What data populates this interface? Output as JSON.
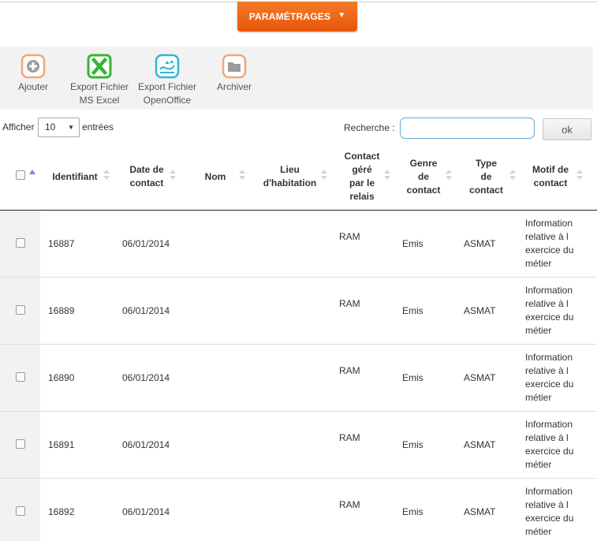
{
  "header": {
    "settings_label": "PARAMÉTRAGES",
    "settings_caret": "▼"
  },
  "toolbar": {
    "add": "Ajouter",
    "excel_line1": "Export Fichier",
    "excel_line2": "MS Excel",
    "oo_line1": "Export Fichier",
    "oo_line2": "OpenOffice",
    "archive": "Archiver"
  },
  "controls": {
    "show_label": "Afficher",
    "page_length": "10",
    "entries_label": "entrées",
    "search_label": "Recherche :",
    "search_value": "",
    "ok_label": "ok"
  },
  "table": {
    "headers": {
      "identifiant": "Identifiant",
      "date_l1": "Date de",
      "date_l2": "contact",
      "nom": "Nom",
      "lieu_l1": "Lieu",
      "lieu_l2": "d'habitation",
      "relais_l1": "Contact",
      "relais_l2": "géré",
      "relais_l3": "par le",
      "relais_l4": "relais",
      "genre_l1": "Genre",
      "genre_l2": "de",
      "genre_l3": "contact",
      "type_l1": "Type",
      "type_l2": "de",
      "type_l3": "contact",
      "motif_l1": "Motif de",
      "motif_l2": "contact"
    },
    "rows": [
      {
        "id": "16887",
        "date": "06/01/2014",
        "relais": "RAM",
        "genre": "Emis",
        "type": "ASMAT",
        "motif_l1": "Information",
        "motif_l2": "relative à l",
        "motif_l3": "exercice du",
        "motif_l4": "métier"
      },
      {
        "id": "16889",
        "date": "06/01/2014",
        "relais": "RAM",
        "genre": "Emis",
        "type": "ASMAT",
        "motif_l1": "Information",
        "motif_l2": "relative à l",
        "motif_l3": "exercice du",
        "motif_l4": "métier"
      },
      {
        "id": "16890",
        "date": "06/01/2014",
        "relais": "RAM",
        "genre": "Emis",
        "type": "ASMAT",
        "motif_l1": "Information",
        "motif_l2": "relative à l",
        "motif_l3": "exercice du",
        "motif_l4": "métier"
      },
      {
        "id": "16891",
        "date": "06/01/2014",
        "relais": "RAM",
        "genre": "Emis",
        "type": "ASMAT",
        "motif_l1": "Information",
        "motif_l2": "relative à l",
        "motif_l3": "exercice du",
        "motif_l4": "métier"
      },
      {
        "id": "16892",
        "date": "06/01/2014",
        "relais": "RAM",
        "genre": "Emis",
        "type": "ASMAT",
        "motif_l1": "Information",
        "motif_l2": "relative à l",
        "motif_l3": "exercice du",
        "motif_l4": "métier"
      }
    ]
  },
  "icons": {
    "add": "add-icon",
    "excel": "excel-icon",
    "openoffice": "openoffice-icon",
    "archive": "archive-folder-icon"
  },
  "colors": {
    "accent": "#f0641a",
    "excel": "#33b533",
    "openoffice": "#2fb7d3",
    "neutral_icon": "#f2a57b",
    "search_border": "#66a8d8"
  }
}
